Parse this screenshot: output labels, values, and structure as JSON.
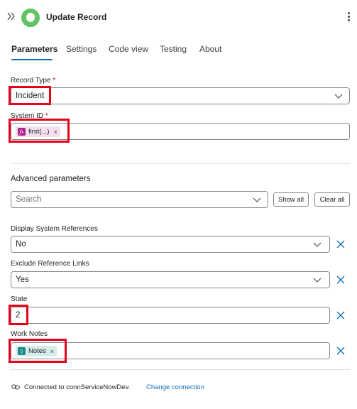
{
  "header": {
    "title": "Update Record",
    "collapse_icon": "double-chevron-right-icon",
    "more_icon": "more-vertical-icon",
    "logo_color": "#62c462"
  },
  "tabs": [
    {
      "label": "Parameters",
      "active": true
    },
    {
      "label": "Settings",
      "active": false
    },
    {
      "label": "Code view",
      "active": false
    },
    {
      "label": "Testing",
      "active": false
    },
    {
      "label": "About",
      "active": false
    }
  ],
  "record_type": {
    "label": "Record Type",
    "required_mark": "*",
    "value": "Incident"
  },
  "system_id": {
    "label": "System ID",
    "required_mark": "*",
    "token_label": "first(...)",
    "token_icon": "function-icon",
    "token_color": "#ae1f8a"
  },
  "advanced": {
    "heading": "Advanced parameters",
    "search_placeholder": "Search",
    "show_all": "Show all",
    "clear_all": "Clear all"
  },
  "display_system_references": {
    "label": "Display System References",
    "value": "No"
  },
  "exclude_reference_links": {
    "label": "Exclude Reference Links",
    "value": "Yes"
  },
  "state": {
    "label": "State",
    "value": "2"
  },
  "work_notes": {
    "label": "Work Notes",
    "token_label": "Notes",
    "token_icon": "servicenow-icon",
    "token_color": "#1f8a8a"
  },
  "footer": {
    "connected_text": "Connected to connServiceNowDev.",
    "change_link": "Change connection",
    "connection_icon": "link-icon"
  },
  "colors": {
    "accent": "#0f6cbd",
    "highlight_box": "#e3001b",
    "remove_x": "#0f6cbd"
  }
}
